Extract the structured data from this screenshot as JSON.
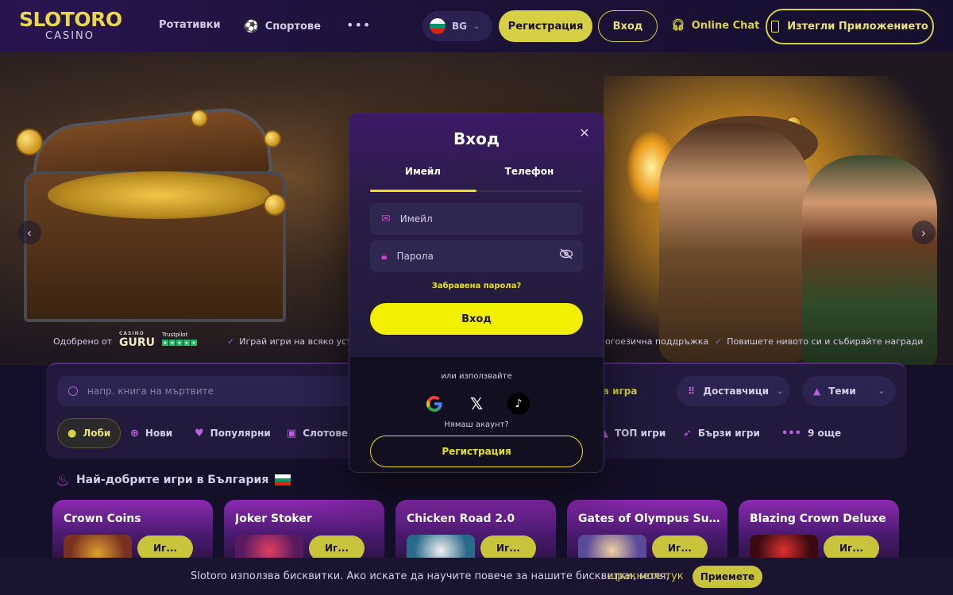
{
  "brand": {
    "logo_main": "SLOTORO",
    "logo_sub": "CASINO"
  },
  "nav": {
    "slots": "Ротативки",
    "sports": "Спортове",
    "more": "•••",
    "language": "BG",
    "register": "Регистрация",
    "login": "Вход",
    "chat": "Online Chat",
    "download_app": "Изтегли Приложението"
  },
  "hero": {
    "trust": {
      "approved_by": "Одобрено от",
      "guru_small": "CASINO",
      "guru": "GURU",
      "trustpilot": "Trustpilot",
      "items": [
        "Играй игри на всяко устро",
        "огоезична поддръжка",
        "Повишете нивото си и събирайте награди"
      ]
    }
  },
  "lobby": {
    "search_placeholder": "напр. книга на мъртвите",
    "filters": {
      "random_game": "айна игра",
      "providers": "Доставчици",
      "themes": "Теми"
    },
    "tabs": [
      {
        "label": "Лоби"
      },
      {
        "label": "Нови"
      },
      {
        "label": "Популярни"
      },
      {
        "label": "Слотове"
      },
      {
        "label": "ТОП игри"
      },
      {
        "label": "Бързи игри"
      },
      {
        "label": "9 още"
      }
    ]
  },
  "games": {
    "section_title": "Най-добрите игри в България",
    "items": [
      {
        "title": "Crown Coins",
        "play": "Иг..."
      },
      {
        "title": "Joker Stoker",
        "play": "Иг..."
      },
      {
        "title": "Chicken Road 2.0",
        "play": "Иг..."
      },
      {
        "title": "Gates of Olympus Super ...",
        "play": "Иг..."
      },
      {
        "title": "Blazing Crown Deluxe",
        "play": "Иг..."
      }
    ]
  },
  "cookie": {
    "text": "Slotoro използва бисквитки. Ако искате да научите повече за нашите бисквитки, моля,",
    "link": "щракнете тук",
    "accept": "Приемете"
  },
  "modal": {
    "title": "Вход",
    "close": "✕",
    "tabs": {
      "email": "Имейл",
      "phone": "Телефон"
    },
    "email_placeholder": "Имейл",
    "password_placeholder": "Парола",
    "forgot": "Забравена парола?",
    "login_button": "Вход",
    "or_use": "или използвайте",
    "social": [
      "google-icon",
      "x-icon",
      "tiktok-icon"
    ],
    "no_account": "Нямаш акаунт?",
    "register_button": "Регистрация"
  },
  "colors": {
    "accent": "#d6d044",
    "modal_button": "#f2f000",
    "background": "#15102a"
  }
}
